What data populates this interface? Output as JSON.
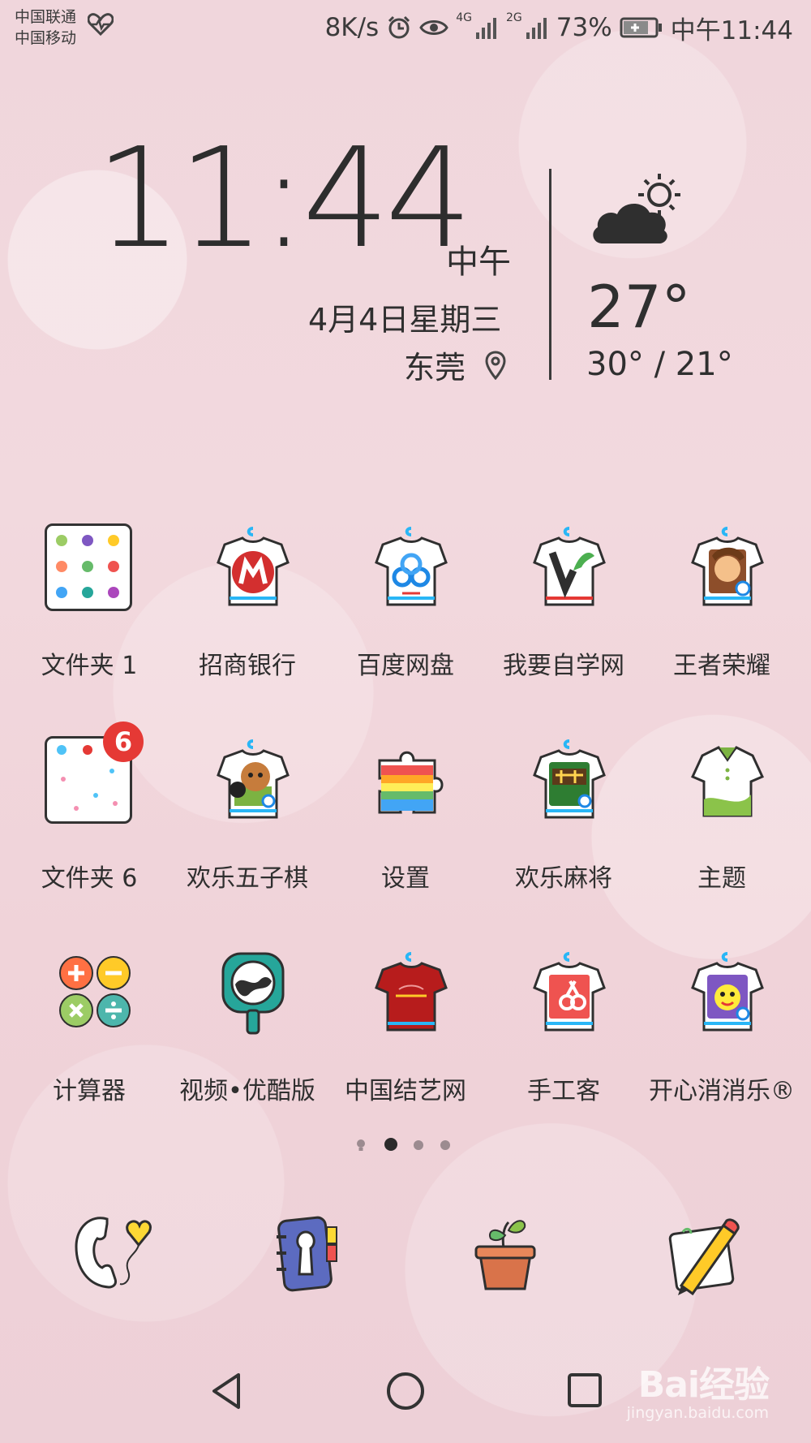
{
  "status_bar": {
    "carrier1": "中国联通",
    "carrier2": "中国移动",
    "net_speed": "8K/s",
    "signal1": "4G",
    "signal2": "2G",
    "battery": "73%",
    "time": "中午11:44"
  },
  "widget": {
    "clock": "11:44",
    "ampm": "中午",
    "date": "4月4日星期三",
    "location": "东莞",
    "temp": "27°",
    "temp_range": "30° / 21°"
  },
  "apps": [
    {
      "label": "文件夹 1",
      "icon": "folder-icon"
    },
    {
      "label": "招商银行",
      "icon": "cmb-bank-icon"
    },
    {
      "label": "百度网盘",
      "icon": "baidu-netdisk-icon"
    },
    {
      "label": "我要自学网",
      "icon": "woyaozixue-icon"
    },
    {
      "label": "王者荣耀",
      "icon": "honor-of-kings-icon"
    },
    {
      "label": "文件夹 6",
      "icon": "folder-icon",
      "badge": "6"
    },
    {
      "label": "欢乐五子棋",
      "icon": "gomoku-icon"
    },
    {
      "label": "设置",
      "icon": "settings-icon"
    },
    {
      "label": "欢乐麻将",
      "icon": "mahjong-icon"
    },
    {
      "label": "主题",
      "icon": "theme-icon"
    },
    {
      "label": "计算器",
      "icon": "calculator-icon"
    },
    {
      "label": "视频•优酷版",
      "icon": "youku-icon"
    },
    {
      "label": "中国结艺网",
      "icon": "chinese-knot-icon"
    },
    {
      "label": "手工客",
      "icon": "handcraft-icon"
    },
    {
      "label": "开心消消乐®",
      "icon": "happy-match-icon"
    }
  ],
  "dock": [
    {
      "icon": "phone-icon"
    },
    {
      "icon": "contacts-icon"
    },
    {
      "icon": "plant-icon"
    },
    {
      "icon": "notes-icon"
    }
  ],
  "watermark": {
    "logo": "Bai经验",
    "url": "jingyan.baidu.com"
  },
  "colors": {
    "background": "#f0d6dc",
    "text": "#2f2f2f",
    "badge": "#e53935"
  }
}
